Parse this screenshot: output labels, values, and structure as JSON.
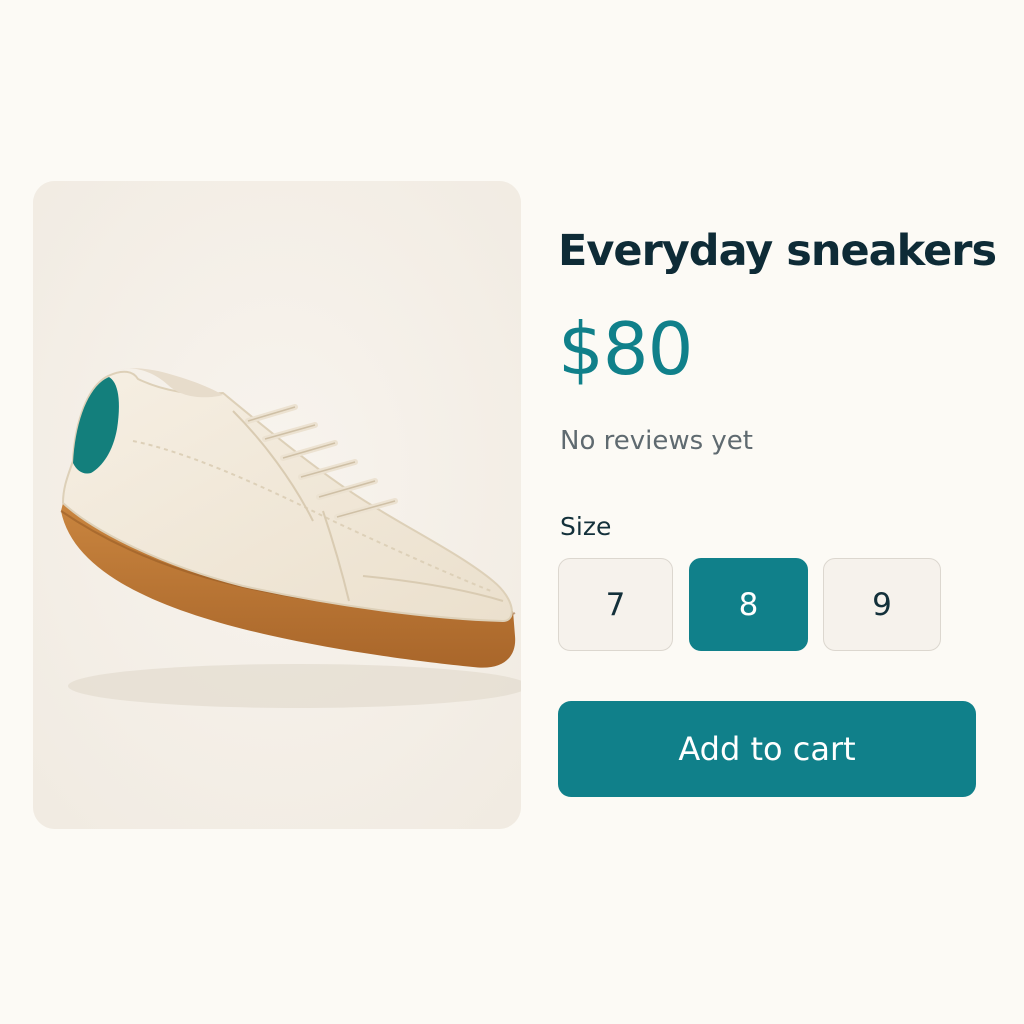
{
  "product": {
    "title": "Everyday sneakers",
    "price": "$80",
    "reviews": "No reviews yet",
    "image_alt": "sneaker"
  },
  "size": {
    "label": "Size",
    "options": [
      "7",
      "8",
      "9"
    ],
    "selected": "8"
  },
  "actions": {
    "add_to_cart": "Add to cart"
  },
  "colors": {
    "accent": "#10808a",
    "heel_tab": "#137f7c",
    "sole": "#c07a3a",
    "upper": "#f1e8d8",
    "title_text": "#0e2b36",
    "page_bg": "#fcfaf5"
  }
}
